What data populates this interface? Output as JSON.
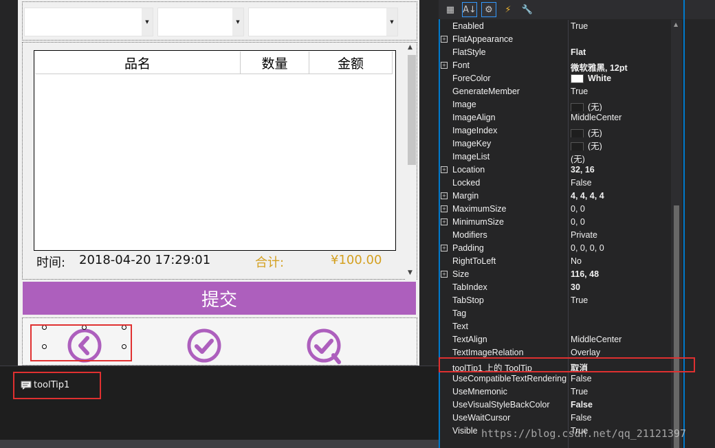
{
  "form": {
    "grid_headers": [
      "品名",
      "数量",
      "金额"
    ],
    "time_label": "时间:",
    "time_value": "2018-04-20 17:29:01",
    "total_label": "合计:",
    "total_value": "¥100.00",
    "submit_label": "提交"
  },
  "tray": {
    "component_name": "toolTip1"
  },
  "colors": {
    "accent_purple": "#ad5fbd",
    "gold": "#d4a020",
    "highlight_red": "#e03030",
    "vs_blue": "#007acc"
  },
  "properties": [
    {
      "name": "Enabled",
      "value": "True",
      "expand": false,
      "bold": false
    },
    {
      "name": "FlatAppearance",
      "value": "",
      "expand": true,
      "bold": false
    },
    {
      "name": "FlatStyle",
      "value": "Flat",
      "expand": false,
      "bold": true
    },
    {
      "name": "Font",
      "value": "微软雅黑, 12pt",
      "expand": true,
      "bold": true
    },
    {
      "name": "ForeColor",
      "value": "White",
      "expand": false,
      "bold": true,
      "swatch": "#ffffff"
    },
    {
      "name": "GenerateMember",
      "value": "True",
      "expand": false,
      "bold": false
    },
    {
      "name": "Image",
      "value": "(无)",
      "expand": false,
      "bold": false,
      "swatch": "#1e1e1e"
    },
    {
      "name": "ImageAlign",
      "value": "MiddleCenter",
      "expand": false,
      "bold": false
    },
    {
      "name": "ImageIndex",
      "value": "(无)",
      "expand": false,
      "bold": false,
      "swatch": "#1e1e1e"
    },
    {
      "name": "ImageKey",
      "value": "(无)",
      "expand": false,
      "bold": false,
      "swatch": "#1e1e1e"
    },
    {
      "name": "ImageList",
      "value": "(无)",
      "expand": false,
      "bold": false
    },
    {
      "name": "Location",
      "value": "32, 16",
      "expand": true,
      "bold": true
    },
    {
      "name": "Locked",
      "value": "False",
      "expand": false,
      "bold": false
    },
    {
      "name": "Margin",
      "value": "4, 4, 4, 4",
      "expand": true,
      "bold": true
    },
    {
      "name": "MaximumSize",
      "value": "0, 0",
      "expand": true,
      "bold": false
    },
    {
      "name": "MinimumSize",
      "value": "0, 0",
      "expand": true,
      "bold": false
    },
    {
      "name": "Modifiers",
      "value": "Private",
      "expand": false,
      "bold": false
    },
    {
      "name": "Padding",
      "value": "0, 0, 0, 0",
      "expand": true,
      "bold": false
    },
    {
      "name": "RightToLeft",
      "value": "No",
      "expand": false,
      "bold": false
    },
    {
      "name": "Size",
      "value": "116, 48",
      "expand": true,
      "bold": true
    },
    {
      "name": "TabIndex",
      "value": "30",
      "expand": false,
      "bold": true
    },
    {
      "name": "TabStop",
      "value": "True",
      "expand": false,
      "bold": false
    },
    {
      "name": "Tag",
      "value": "",
      "expand": false,
      "bold": false
    },
    {
      "name": "Text",
      "value": "",
      "expand": false,
      "bold": false
    },
    {
      "name": "TextAlign",
      "value": "MiddleCenter",
      "expand": false,
      "bold": false
    },
    {
      "name": "TextImageRelation",
      "value": "Overlay",
      "expand": false,
      "bold": false
    },
    {
      "name": "toolTip1 上的 ToolTip",
      "value": "取消",
      "expand": false,
      "bold": true
    },
    {
      "name": "UseCompatibleTextRendering",
      "value": "False",
      "expand": false,
      "bold": false
    },
    {
      "name": "UseMnemonic",
      "value": "True",
      "expand": false,
      "bold": false
    },
    {
      "name": "UseVisualStyleBackColor",
      "value": "False",
      "expand": false,
      "bold": true
    },
    {
      "name": "UseWaitCursor",
      "value": "False",
      "expand": false,
      "bold": false
    },
    {
      "name": "Visible",
      "value": "True",
      "expand": false,
      "bold": false
    }
  ],
  "toolbar_icons": [
    "categorized-icon",
    "alphabetical-icon",
    "properties-icon",
    "events-icon",
    "property-pages-icon"
  ],
  "watermark": "https://blog.csdn.net/qq_21121397"
}
